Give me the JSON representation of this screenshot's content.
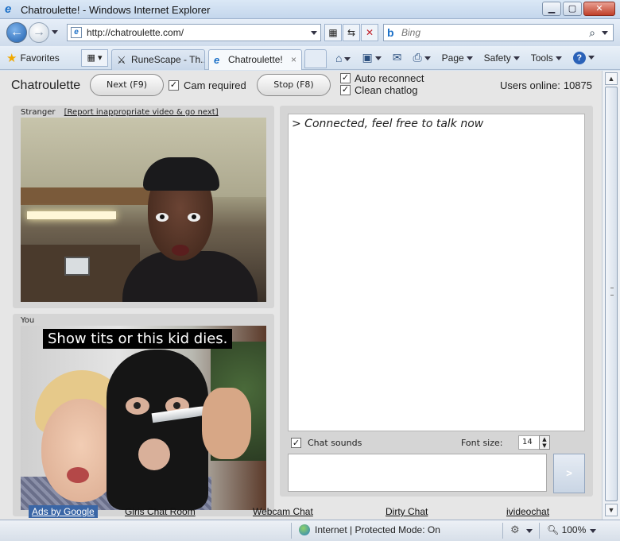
{
  "window": {
    "title": "Chatroulette! - Windows Internet Explorer",
    "controls": {
      "minimize": "▁",
      "maximize": "▢",
      "close": "✕"
    }
  },
  "address_bar": {
    "url": "http://chatroulette.com/",
    "search_placeholder": "Bing"
  },
  "command_bar": {
    "favorites_label": "Favorites",
    "tabs": [
      {
        "label": "RuneScape - Th...",
        "active": false
      },
      {
        "label": "Chatroulette!",
        "active": true
      }
    ],
    "tab_close": "×",
    "page_label": "Page",
    "safety_label": "Safety",
    "tools_label": "Tools",
    "help_label": "?"
  },
  "site": {
    "brand": "Chatroulette",
    "next_button": "Next (F9)",
    "cam_required_label": "Cam required",
    "cam_required_checked": true,
    "stop_button": "Stop (F8)",
    "auto_reconnect_label": "Auto reconnect",
    "auto_reconnect_checked": true,
    "clean_chatlog_label": "Clean chatlog",
    "clean_chatlog_checked": true,
    "users_online_label": "Users online:",
    "users_online_count": "10875"
  },
  "stranger_panel": {
    "label": "Stranger",
    "report_link": "[Report inappropriate video & go next]"
  },
  "you_panel": {
    "label": "You",
    "caption": "Show tits or this kid dies."
  },
  "chat": {
    "log_line": "> Connected, feel free to talk now",
    "sounds_label": "Chat sounds",
    "sounds_checked": true,
    "font_size_label": "Font size:",
    "font_size_value": "14",
    "send_label": ">"
  },
  "footer_links": [
    {
      "label": "Ads by Google"
    },
    {
      "label": "Girls Chat Room"
    },
    {
      "label": "Webcam Chat"
    },
    {
      "label": "Dirty Chat"
    },
    {
      "label": "ivideochat"
    }
  ],
  "status_bar": {
    "zone": "Internet | Protected Mode: On",
    "zoom": "100%"
  },
  "colors": {
    "ie_blue": "#1a6fc7",
    "ads_bg": "#3a66a6",
    "close_red": "#c0402a"
  }
}
